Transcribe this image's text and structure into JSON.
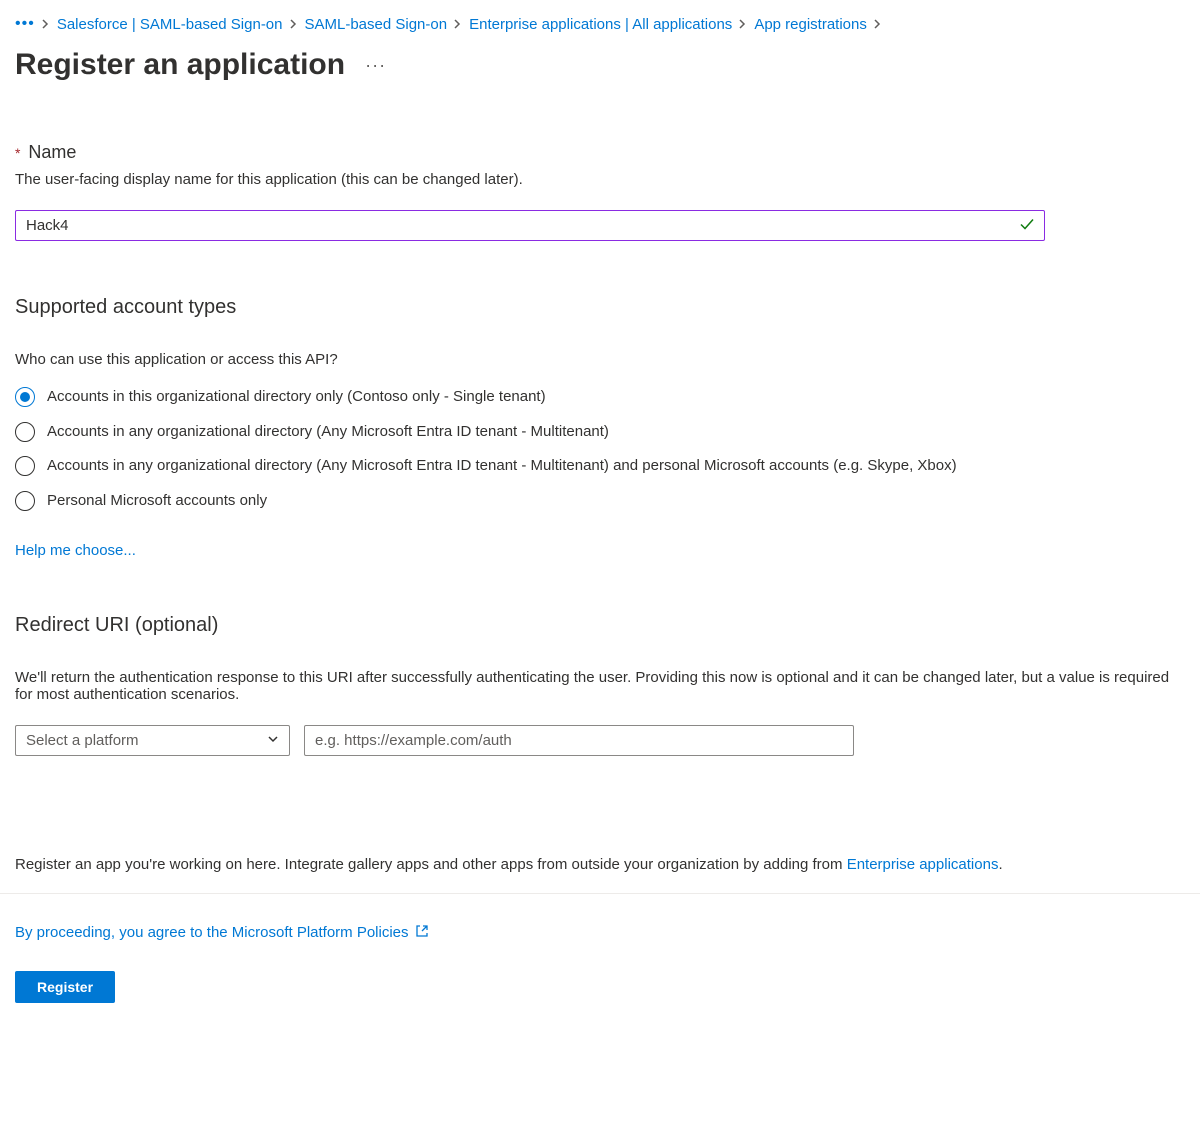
{
  "breadcrumb": {
    "items": [
      "Salesforce | SAML-based Sign-on",
      "SAML-based Sign-on",
      "Enterprise applications | All applications",
      "App registrations"
    ]
  },
  "page": {
    "title": "Register an application"
  },
  "name_section": {
    "label": "Name",
    "hint": "The user-facing display name for this application (this can be changed later).",
    "value": "Hack4"
  },
  "account_types": {
    "heading": "Supported account types",
    "question": "Who can use this application or access this API?",
    "options": [
      "Accounts in this organizational directory only (Contoso only - Single tenant)",
      "Accounts in any organizational directory (Any Microsoft Entra ID tenant - Multitenant)",
      "Accounts in any organizational directory (Any Microsoft Entra ID tenant - Multitenant) and personal Microsoft accounts (e.g. Skype, Xbox)",
      "Personal Microsoft accounts only"
    ],
    "help_link": "Help me choose..."
  },
  "redirect_uri": {
    "heading": "Redirect URI (optional)",
    "hint": "We'll return the authentication response to this URI after successfully authenticating the user. Providing this now is optional and it can be changed later, but a value is required for most authentication scenarios.",
    "platform_placeholder": "Select a platform",
    "uri_placeholder": "e.g. https://example.com/auth"
  },
  "footer": {
    "note_prefix": "Register an app you're working on here. Integrate gallery apps and other apps from outside your organization by adding from ",
    "note_link": "Enterprise applications",
    "note_suffix": ".",
    "policy_text": "By proceeding, you agree to the Microsoft Platform Policies",
    "register_label": "Register"
  }
}
